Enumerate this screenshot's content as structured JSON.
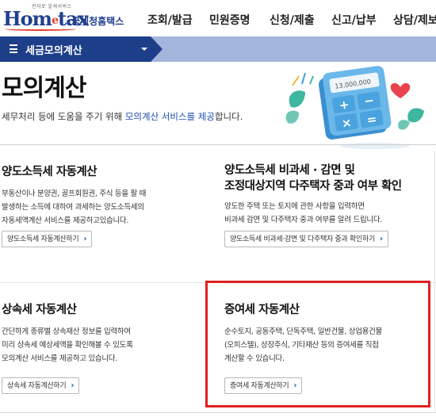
{
  "header": {
    "logo_small": "전자로 알세서비스",
    "logo_text": "Hom",
    "logo_e": "e",
    "logo_text2": "tax",
    "logo_kr": "국세청홈택스",
    "nav": [
      "조회/발급",
      "민원증명",
      "신청/제출",
      "신고/납부",
      "상담/제보"
    ]
  },
  "subbar": {
    "label": "세금모의계산"
  },
  "hero": {
    "title": "모의계산",
    "desc_pre": "세무처리 등에 도움을 주기 위해 ",
    "desc_highlight": "모의계산 서비스를 제공",
    "desc_post": "합니다.",
    "illus_amount": "13,000,000"
  },
  "cards": [
    {
      "title": "양도소득세 자동계산",
      "desc": [
        "부동산이나 분양권, 골프회원권, 주식 등을 팔 때",
        "발생하는 소득에 대하여 과세하는 양도소득세의",
        "자동세액계산 서비스를 제공하고있습니다."
      ],
      "button": "양도소득세 자동계산하기"
    },
    {
      "title": "양도소득세 비과세 · 감면 및",
      "title2": "조정대상지역 다주택자 중과 여부 확인",
      "desc": [
        "양도한 주택 또는 토지에 관한 사항을 입력하면",
        "비과세 감면 및 다주택자 중과 여부를 알려 드립니다."
      ],
      "button": "양도소득세 비과세·감면 및 다주택자 중과 확인하기"
    },
    {
      "title": "상속세 자동계산",
      "desc": [
        "간단하게 종류별 상속재산 정보를 입력하여",
        "미리 상속세 예상세액을 확인해볼 수 있도록",
        "모의계산 서비스를 제공하고 있습니다."
      ],
      "button": "상속세 자동계산하기"
    },
    {
      "title": "증여세 자동계산",
      "desc": [
        "순수토지, 공동주택, 단독주택, 일반건물, 상업용건물",
        "(오피스텔), 상장주식, 기타재산 등의 증여세를 직접",
        "계산할 수 있습니다."
      ],
      "button": "증여세 자동계산하기"
    }
  ],
  "colors": {
    "brand_blue": "#1d3f8a",
    "subbar_light": "#a4b6dc",
    "highlight_red": "#e02020",
    "link_blue": "#1f4fb0"
  },
  "icons": [
    "menu-icon",
    "caret-down-icon",
    "chevron-right-icon",
    "calculator-illustration",
    "heart-icon",
    "leaf-icon"
  ]
}
